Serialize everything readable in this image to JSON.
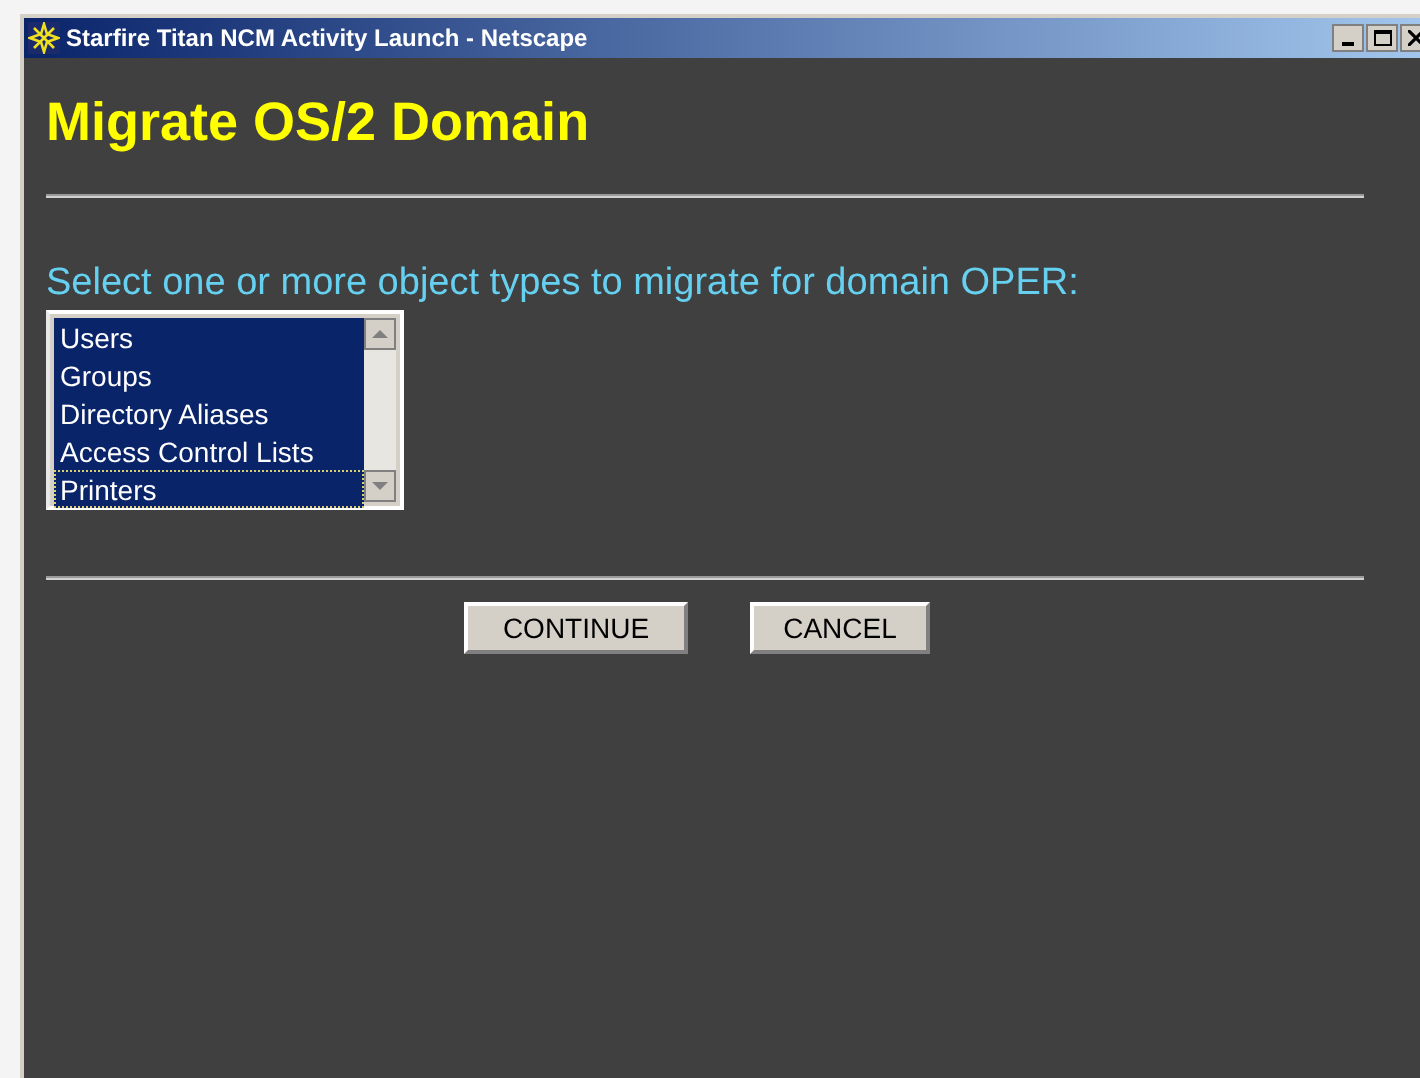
{
  "window": {
    "title": "Starfire Titan NCM Activity Launch - Netscape"
  },
  "heading": "Migrate OS/2 Domain",
  "prompt": "Select one or more object types to migrate for domain OPER:",
  "object_types": [
    {
      "label": "Users",
      "selected": true,
      "focused": false
    },
    {
      "label": "Groups",
      "selected": true,
      "focused": false
    },
    {
      "label": "Directory Aliases",
      "selected": true,
      "focused": false
    },
    {
      "label": "Access Control Lists",
      "selected": true,
      "focused": false
    },
    {
      "label": "Printers",
      "selected": true,
      "focused": true
    }
  ],
  "buttons": [
    "CONTINUE",
    "CANCEL"
  ]
}
